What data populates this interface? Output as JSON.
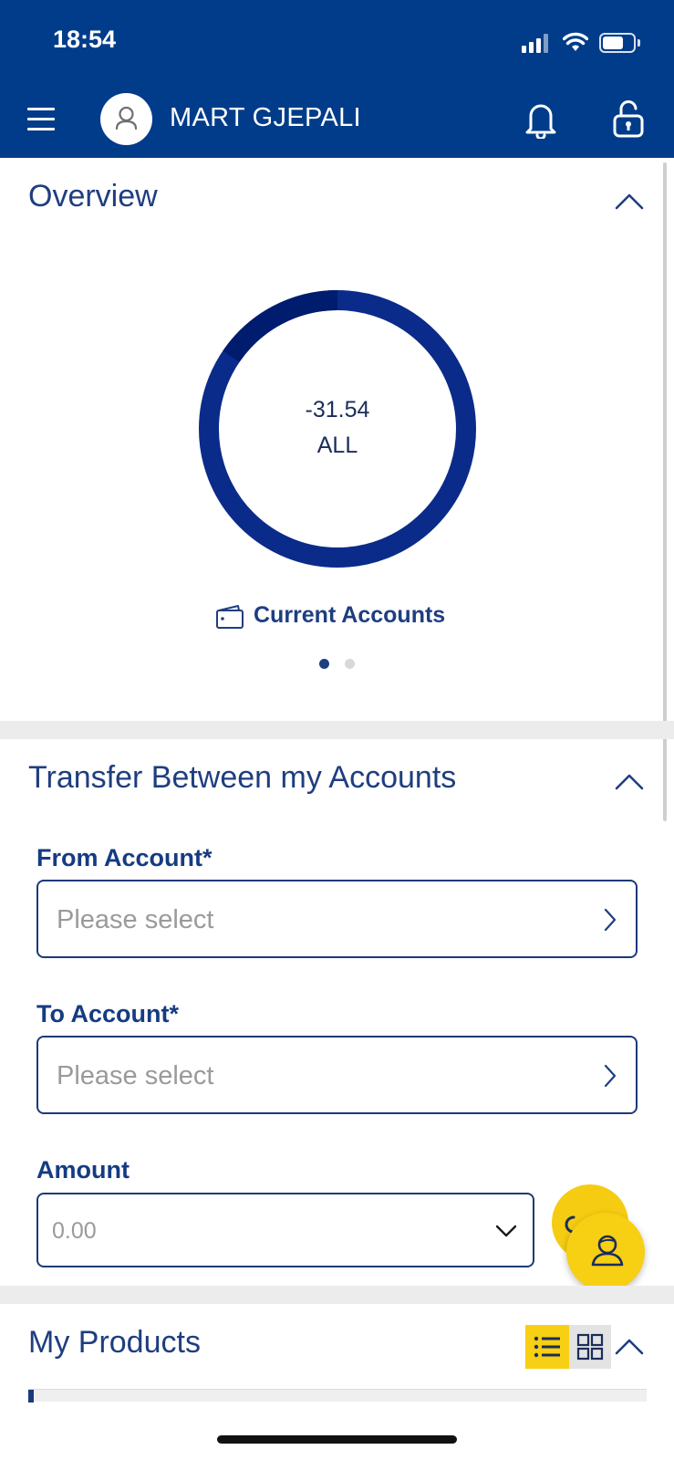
{
  "status_bar": {
    "time": "18:54"
  },
  "header": {
    "user_name": "MART GJEPALI"
  },
  "overview": {
    "title": "Overview",
    "balance": "-31.54",
    "currency": "ALL",
    "account_type": "Current Accounts",
    "active_page": 1,
    "page_count": 2,
    "colors": {
      "ring": "#0a2b8a",
      "ring_segment": "#001c6e"
    }
  },
  "transfer": {
    "title": "Transfer Between my Accounts",
    "from_label": "From Account",
    "from_placeholder": "Please select",
    "to_label": "To Account",
    "to_placeholder": "Please select",
    "required_marker": "*",
    "amount_label": "Amount",
    "amount_placeholder": "0.00"
  },
  "products": {
    "title": "My Products",
    "view_mode": "list"
  },
  "colors": {
    "brand": "#003c8a",
    "accent": "#f7cf13",
    "text": "#1f3e80"
  }
}
